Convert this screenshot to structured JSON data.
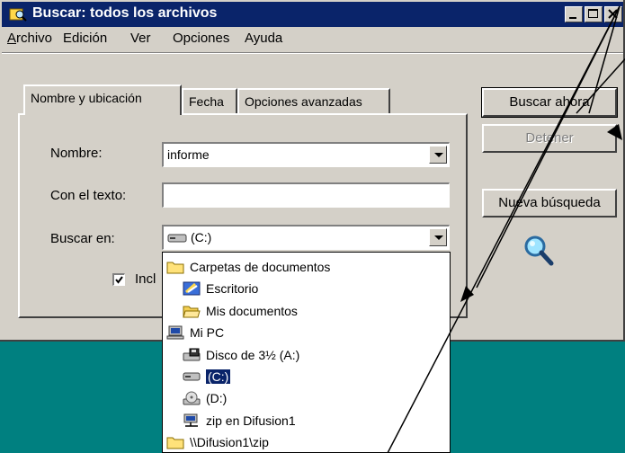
{
  "window": {
    "title": "Buscar: todos los archivos"
  },
  "menu": [
    {
      "label": "Archivo"
    },
    {
      "label": "Edición"
    },
    {
      "label": "Ver"
    },
    {
      "label": "Opciones"
    },
    {
      "label": "Ayuda"
    }
  ],
  "tabs": [
    {
      "label": "Nombre y ubicación",
      "active": true
    },
    {
      "label": "Fecha",
      "active": false
    },
    {
      "label": "Opciones avanzadas",
      "active": false
    }
  ],
  "form": {
    "nombre_label": "Nombre:",
    "nombre_value": "informe",
    "texto_label": "Con el texto:",
    "texto_value": "",
    "buscar_en_label": "Buscar en:",
    "buscar_en_value": "(C:)",
    "incluir_label": "Incl",
    "incluir_checked": true
  },
  "buttons": {
    "buscar_ahora": "Buscar ahora",
    "detener": "Detener",
    "nueva_busqueda": "Nueva búsqueda"
  },
  "dropdown_items": [
    {
      "label": "Carpetas de documentos",
      "icon": "folder-icon",
      "level": 0,
      "selected": false
    },
    {
      "label": "Escritorio",
      "icon": "desktop-icon",
      "level": 1,
      "selected": false
    },
    {
      "label": "Mis documentos",
      "icon": "open-folder-icon",
      "level": 1,
      "selected": false
    },
    {
      "label": "Mi PC",
      "icon": "computer-icon",
      "level": 0,
      "selected": false
    },
    {
      "label": "Disco de 3½ (A:)",
      "icon": "floppy-drive-icon",
      "level": 1,
      "selected": false
    },
    {
      "label": "(C:)",
      "icon": "hard-drive-icon",
      "level": 1,
      "selected": true
    },
    {
      "label": "(D:)",
      "icon": "cd-drive-icon",
      "level": 1,
      "selected": false
    },
    {
      "label": "zip en Difusion1",
      "icon": "network-drive-icon",
      "level": 1,
      "selected": false
    },
    {
      "label": "\\\\Difusion1\\zip",
      "icon": "folder-icon",
      "level": 0,
      "selected": false
    }
  ],
  "colors": {
    "desktop": "#008080",
    "title_bar": "#0a246a",
    "face": "#d4d0c8",
    "selection": "#0a246a"
  }
}
